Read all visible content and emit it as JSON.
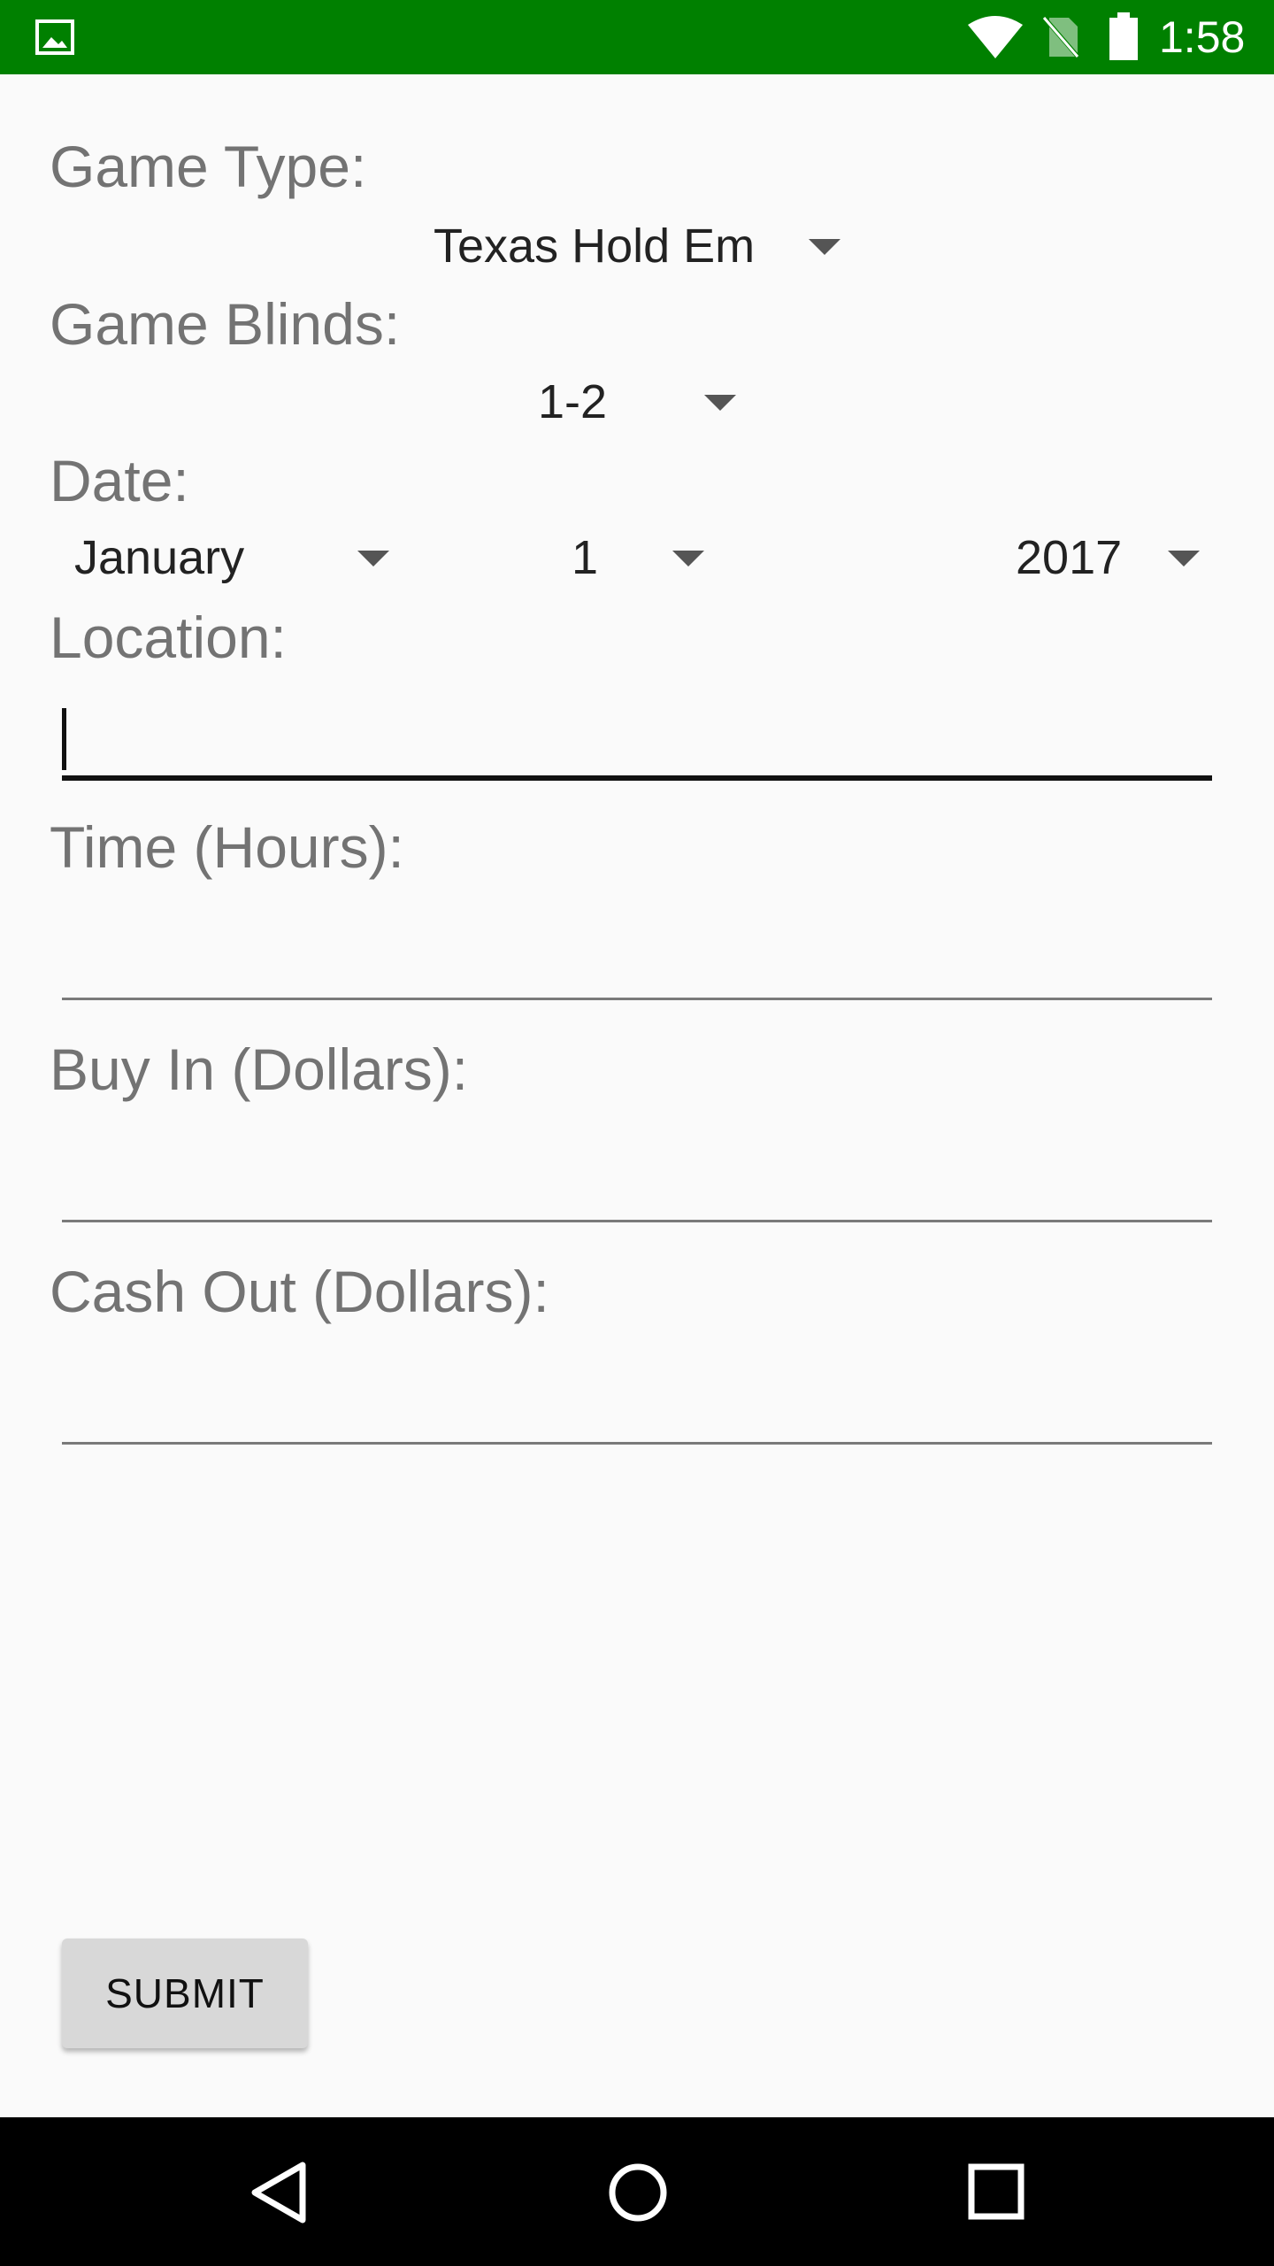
{
  "status_bar": {
    "time": "1:58",
    "background_color": "#008000",
    "icons": [
      "image-icon",
      "wifi-icon",
      "no-sim-icon",
      "battery-icon"
    ]
  },
  "form": {
    "game_type": {
      "label": "Game Type:",
      "selected": "Texas Hold Em"
    },
    "game_blinds": {
      "label": "Game Blinds:",
      "selected": "1-2"
    },
    "date": {
      "label": "Date:",
      "month": "January",
      "day": "1",
      "year": "2017"
    },
    "location": {
      "label": "Location:",
      "value": ""
    },
    "time_hours": {
      "label": "Time (Hours):",
      "value": ""
    },
    "buy_in": {
      "label": "Buy In (Dollars):",
      "value": ""
    },
    "cash_out": {
      "label": "Cash Out (Dollars):",
      "value": ""
    },
    "submit_label": "SUBMIT"
  },
  "nav_bar": {
    "buttons": [
      "back-icon",
      "home-icon",
      "recents-icon"
    ]
  }
}
